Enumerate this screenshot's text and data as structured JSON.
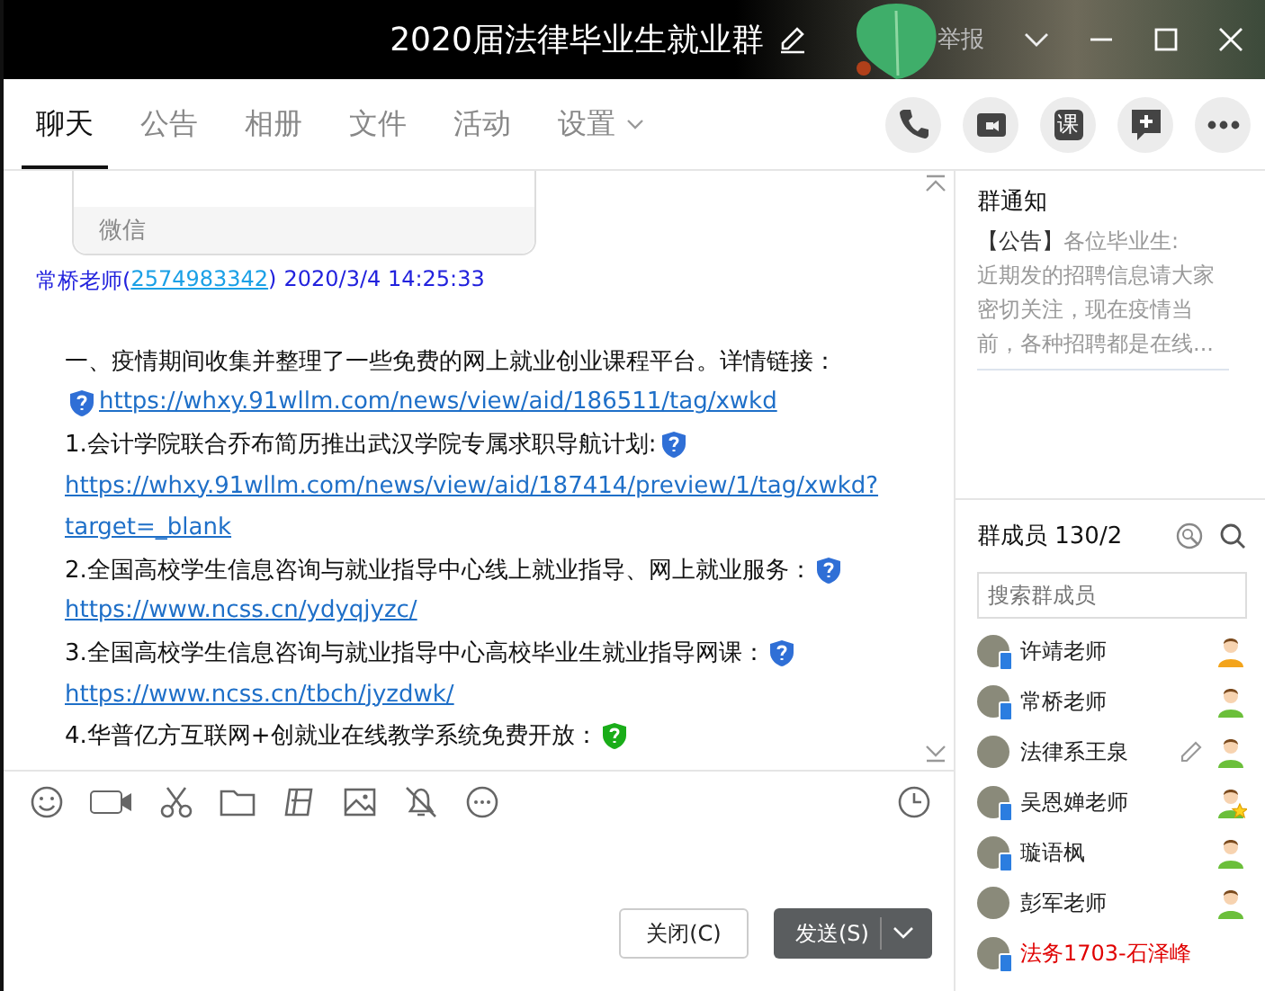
{
  "window": {
    "title": "2020届法律毕业生就业群",
    "report": "举报"
  },
  "tabs": [
    {
      "label": "聊天",
      "selected": true,
      "dropdown": false
    },
    {
      "label": "公告",
      "selected": false,
      "dropdown": false
    },
    {
      "label": "相册",
      "selected": false,
      "dropdown": false
    },
    {
      "label": "文件",
      "selected": false,
      "dropdown": false
    },
    {
      "label": "活动",
      "selected": false,
      "dropdown": false
    },
    {
      "label": "设置",
      "selected": false,
      "dropdown": true
    }
  ],
  "course_button_label": "课",
  "chat": {
    "card_footer": "微信",
    "message": {
      "sender": "常桥老师(",
      "sender_id": "2574983342",
      "id_close": ")",
      "time": "2020/3/4 14:25:33",
      "lines": [
        {
          "kind": "text",
          "text": "一、疫情期间收集并整理了一些免费的网上就业创业课程平台。详情链接："
        },
        {
          "kind": "link",
          "text": "https://whxy.91wllm.com/news/view/aid/186511/tag/xwkd",
          "leading_icon": {
            "color": "#2f6fd6"
          }
        },
        {
          "kind": "text",
          "text": "1.会计学院联合乔布简历推出武汉学院专属求职导航计划:",
          "trailing_icon": {
            "color": "#2f6fd6"
          }
        },
        {
          "kind": "link",
          "text": "https://whxy.91wllm.com/news/view/aid/187414/preview/1/tag/xwkd?"
        },
        {
          "kind": "link",
          "text": "target=_blank"
        },
        {
          "kind": "text",
          "text": "2.全国高校学生信息咨询与就业指导中心线上就业指导、网上就业服务：",
          "trailing_icon": {
            "color": "#2f6fd6"
          }
        },
        {
          "kind": "link",
          "text": "https://www.ncss.cn/ydyqjyzc/"
        },
        {
          "kind": "text",
          "text": "3.全国高校学生信息咨询与就业指导中心高校毕业生就业指导网课：",
          "trailing_icon": {
            "color": "#2f6fd6"
          }
        },
        {
          "kind": "link",
          "text": "https://www.ncss.cn/tbch/jyzdwk/"
        },
        {
          "kind": "text",
          "text": "4.华普亿方互联网+创就业在线教学系统免费开放：",
          "trailing_icon": {
            "color": "#1aad19"
          }
        }
      ]
    }
  },
  "buttons": {
    "close": "关闭(C)",
    "send": "发送(S)"
  },
  "notice": {
    "title": "群通知",
    "tag": "【公告】",
    "text": "各位毕业生:\n 近期发的招聘信息请大家密切关注，现在疫情当前，各种招聘都是在线..."
  },
  "members": {
    "title": "群成员 130/2",
    "search": {
      "placeholder": "搜索群成员"
    },
    "list": [
      {
        "name": "许靖老师",
        "mobile": true,
        "editable": false,
        "highlighted": false,
        "owner": true,
        "admin": false,
        "star": false
      },
      {
        "name": "常桥老师",
        "mobile": true,
        "editable": false,
        "highlighted": false,
        "owner": false,
        "admin": true,
        "star": false
      },
      {
        "name": "法律系王泉",
        "mobile": false,
        "editable": true,
        "highlighted": false,
        "owner": false,
        "admin": true,
        "star": false
      },
      {
        "name": "吴恩婵老师",
        "mobile": true,
        "editable": false,
        "highlighted": false,
        "owner": false,
        "admin": true,
        "star": true
      },
      {
        "name": "璇语枫",
        "mobile": true,
        "editable": false,
        "highlighted": false,
        "owner": false,
        "admin": true,
        "star": false
      },
      {
        "name": "彭军老师",
        "mobile": false,
        "editable": false,
        "highlighted": false,
        "owner": false,
        "admin": true,
        "star": false
      },
      {
        "name": "法务1703-石泽峰",
        "mobile": true,
        "editable": false,
        "highlighted": true,
        "owner": false,
        "admin": false,
        "star": false
      }
    ]
  }
}
